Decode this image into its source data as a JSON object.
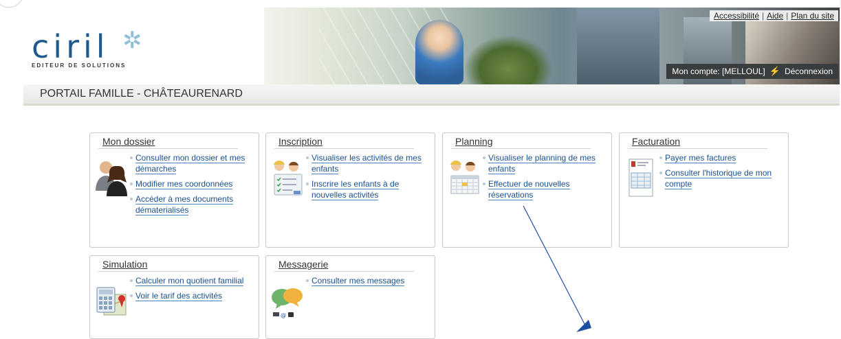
{
  "links": {
    "accessibility": "Accessibilité",
    "help": "Aide",
    "sitemap": "Plan du site",
    "sep": "|"
  },
  "account": {
    "label": "Mon compte: [MELLOUL]",
    "logout": "Déconnexion"
  },
  "logo": {
    "word": "ciril",
    "subtitle": "EDITEUR DE SOLUTIONS"
  },
  "page_title": "PORTAIL FAMILLE - CHÂTEAURENARD",
  "cards": [
    {
      "title": "Mon dossier",
      "icon": "people-icon",
      "items": [
        "Consulter mon dossier et mes démarches",
        "Modifier mes coordonnées",
        "Accéder à mes documents dématerialisés"
      ]
    },
    {
      "title": "Inscription",
      "icon": "kids-checklist-icon",
      "items": [
        "Visualiser les activités de mes enfants",
        "Inscrire les enfants à de nouvelles activités"
      ]
    },
    {
      "title": "Planning",
      "icon": "kids-calendar-icon",
      "items": [
        "Visualiser le planning de mes enfants",
        "Effectuer de nouvelles réservations"
      ]
    },
    {
      "title": "Facturation",
      "icon": "invoice-icon",
      "items": [
        "Payer mes factures",
        "Consulter l'historique de mon compte"
      ]
    },
    {
      "title": "Simulation",
      "icon": "calculator-map-icon",
      "items": [
        "Calculer mon quotient familial",
        "Voir le tarif des activités"
      ]
    },
    {
      "title": "Messagerie",
      "icon": "speech-bubbles-icon",
      "items": [
        "Consulter mes messages"
      ]
    }
  ],
  "colors": {
    "brand": "#1e5a8d",
    "link": "#1a4f8e",
    "annotation_arrow": "#1f4fa3"
  }
}
